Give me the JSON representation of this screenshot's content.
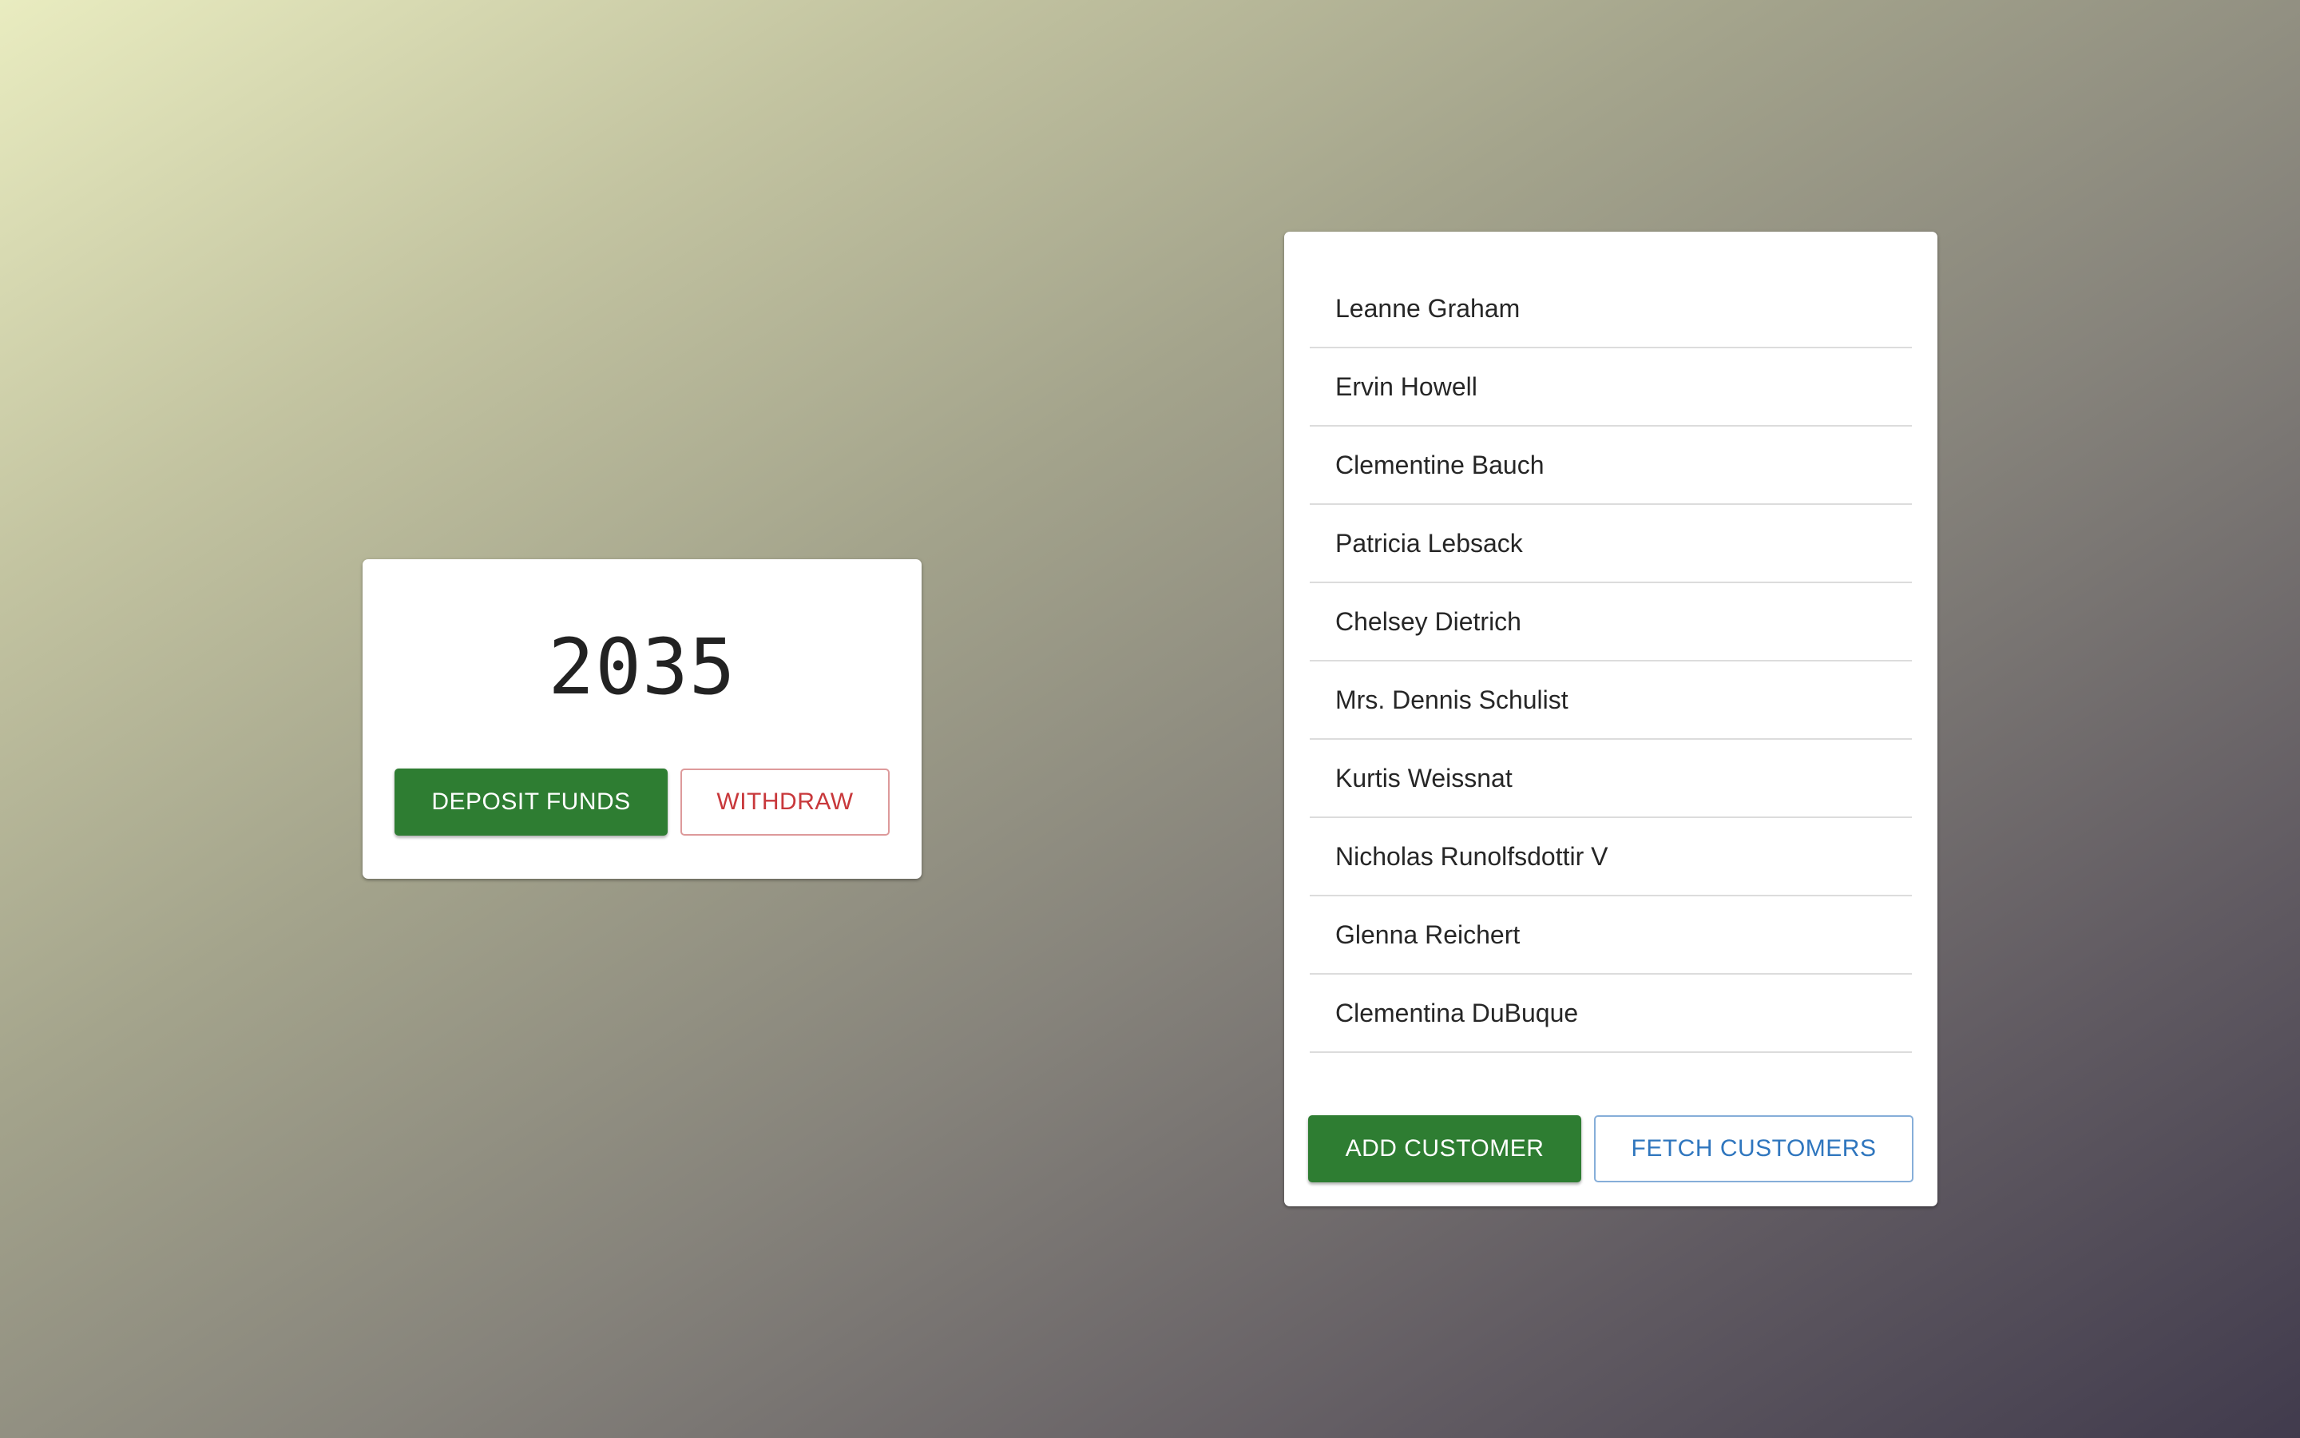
{
  "balance": {
    "value": "2035",
    "deposit_label": "DEPOSIT FUNDS",
    "withdraw_label": "WITHDRAW"
  },
  "customers": {
    "items": [
      {
        "name": "Leanne Graham"
      },
      {
        "name": "Ervin Howell"
      },
      {
        "name": "Clementine Bauch"
      },
      {
        "name": "Patricia Lebsack"
      },
      {
        "name": "Chelsey Dietrich"
      },
      {
        "name": "Mrs. Dennis Schulist"
      },
      {
        "name": "Kurtis Weissnat"
      },
      {
        "name": "Nicholas Runolfsdottir V"
      },
      {
        "name": "Glenna Reichert"
      },
      {
        "name": "Clementina DuBuque"
      }
    ],
    "add_label": "ADD CUSTOMER",
    "fetch_label": "FETCH CUSTOMERS"
  },
  "colors": {
    "primary_green": "#2e7d32",
    "danger_red": "#c8383b",
    "info_blue": "#2f76be"
  }
}
